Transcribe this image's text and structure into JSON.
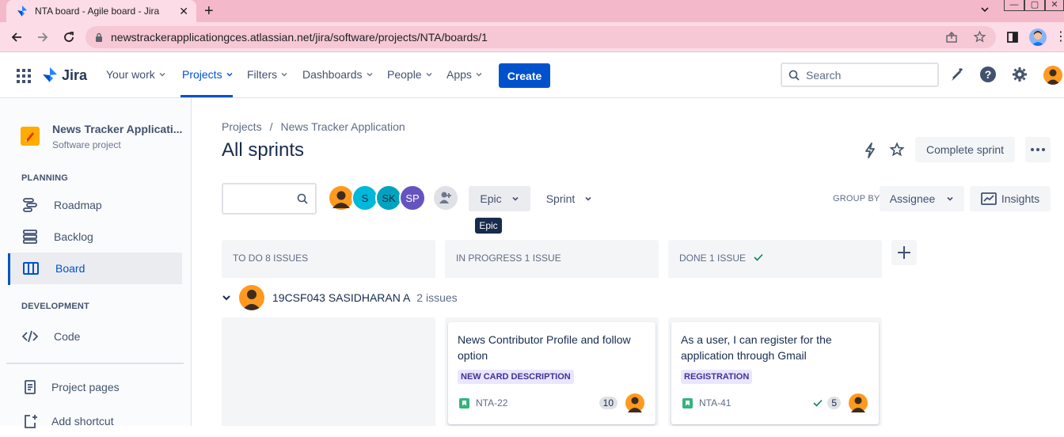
{
  "browser": {
    "tab_title": "NTA board - Agile board - Jira",
    "url": "newstrackerapplicationgces.atlassian.net/jira/software/projects/NTA/boards/1"
  },
  "nav": {
    "product": "Jira",
    "items": [
      "Your work",
      "Projects",
      "Filters",
      "Dashboards",
      "People",
      "Apps"
    ],
    "active": "Projects",
    "create_label": "Create",
    "search_placeholder": "Search"
  },
  "sidebar": {
    "project_name": "News Tracker Applicati...",
    "project_type": "Software project",
    "planning_label": "PLANNING",
    "development_label": "DEVELOPMENT",
    "planning_items": [
      "Roadmap",
      "Backlog",
      "Board"
    ],
    "active_item": "Board",
    "development_items": [
      "Code"
    ],
    "bottom_items": [
      "Project pages",
      "Add shortcut"
    ]
  },
  "page": {
    "breadcrumb_root": "Projects",
    "breadcrumb_sep": "/",
    "breadcrumb_project": "News Tracker Application",
    "title": "All sprints",
    "complete_sprint_label": "Complete sprint"
  },
  "filters": {
    "avatars": [
      {
        "initials": "",
        "color": "#ff991f"
      },
      {
        "initials": "S",
        "color": "#00b8d9"
      },
      {
        "initials": "SK",
        "color": "#00a3bf"
      },
      {
        "initials": "SP",
        "color": "#6554c0"
      }
    ],
    "epic_label": "Epic",
    "sprint_label": "Sprint",
    "tooltip": "Epic",
    "group_by_label": "GROUP BY",
    "group_by_value": "Assignee",
    "insights_label": "Insights"
  },
  "columns": [
    {
      "title": "TO DO 8 ISSUES",
      "done": false
    },
    {
      "title": "IN PROGRESS 1 ISSUE",
      "done": false
    },
    {
      "title": "DONE 1 ISSUE",
      "done": true
    }
  ],
  "swimlane": {
    "name": "19CSF043 SASIDHARAN A",
    "count": "2 issues"
  },
  "cards": [
    {
      "summary": "News Contributor Profile and follow option",
      "epic": "NEW CARD DESCRIPTION",
      "key": "NTA-22",
      "estimate": "10",
      "done": false
    },
    {
      "summary": "As a user, I can register for the application through Gmail",
      "epic": "REGISTRATION",
      "key": "NTA-41",
      "estimate": "5",
      "done": true
    }
  ],
  "colors": {
    "accent": "#0052cc",
    "story": "#36b37e",
    "done_check": "#00875a",
    "epic_lozenge": "#eae6ff"
  }
}
